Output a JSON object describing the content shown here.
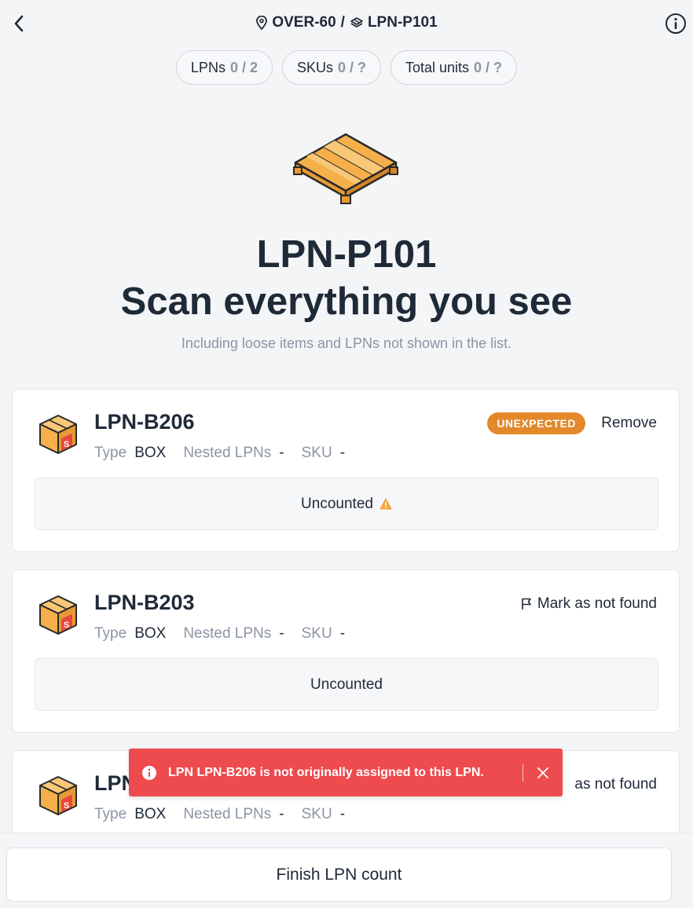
{
  "header": {
    "location": "OVER-60",
    "separator": "/",
    "lpn": "LPN-P101"
  },
  "counters": [
    {
      "label": "LPNs",
      "count": "0 / 2"
    },
    {
      "label": "SKUs",
      "count": "0 / ?"
    },
    {
      "label": "Total units",
      "count": "0 / ?"
    }
  ],
  "hero": {
    "title": "LPN-P101",
    "subtitle": "Scan everything you see",
    "hint": "Including loose items and LPNs not shown in the list."
  },
  "meta_labels": {
    "type": "Type",
    "nested": "Nested LPNs",
    "sku": "SKU"
  },
  "cards": [
    {
      "lpn": "LPN-B206",
      "type": "BOX",
      "nested": "-",
      "sku": "-",
      "badge": "UNEXPECTED",
      "action": "Remove",
      "status": "Uncounted"
    },
    {
      "lpn": "LPN-B203",
      "type": "BOX",
      "nested": "-",
      "sku": "-",
      "action": "Mark as not found",
      "status": "Uncounted"
    },
    {
      "lpn": "LPN",
      "type": "BOX",
      "nested": "-",
      "sku": "-",
      "action": "as not found"
    }
  ],
  "toast": {
    "message": "LPN LPN-B206 is not originally assigned to this LPN."
  },
  "footer": {
    "finish_label": "Finish LPN count"
  },
  "colors": {
    "badge": "#e3892b",
    "toast": "#ee4b4f",
    "warning": "#f2a93b",
    "box": "#f5b04c"
  }
}
